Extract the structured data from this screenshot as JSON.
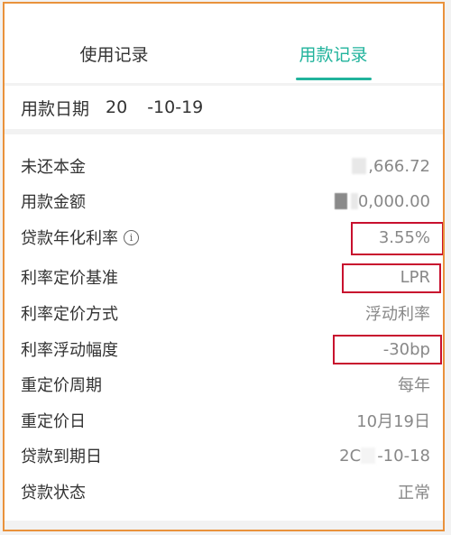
{
  "tabs": [
    {
      "label": "使用记录",
      "active": false
    },
    {
      "label": "用款记录",
      "active": true
    }
  ],
  "loan_date": {
    "label": "用款日期",
    "value_prefix": "20",
    "value_suffix": "-10-19"
  },
  "rows": [
    {
      "key": "未还本金",
      "value": ",666.72"
    },
    {
      "key": "用款金额",
      "value": "0,000.00"
    },
    {
      "key": "贷款年化利率",
      "value": "3.55%",
      "info_icon": "info-icon"
    },
    {
      "key": "利率定价基准",
      "value": "LPR"
    },
    {
      "key": "利率定价方式",
      "value": "浮动利率"
    },
    {
      "key": "利率浮动幅度",
      "value": "-30bp"
    },
    {
      "key": "重定价周期",
      "value": "每年"
    },
    {
      "key": "重定价日",
      "value": "10月19日"
    },
    {
      "key": "贷款到期日",
      "value_prefix": "2C",
      "value_suffix": "-10-18"
    },
    {
      "key": "贷款状态",
      "value": "正常"
    }
  ],
  "colors": {
    "accent": "#21b39c",
    "highlight_border": "#c8102e",
    "frame_border": "#e9923c"
  }
}
